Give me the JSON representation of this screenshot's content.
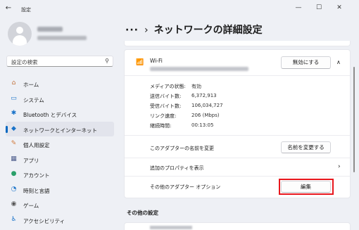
{
  "window": {
    "app_title": "設定",
    "minimize": "—",
    "maximize": "☐",
    "close": "✕"
  },
  "search": {
    "placeholder": "設定の検索"
  },
  "sidebar": {
    "items": [
      {
        "label": "ホーム",
        "icon": "home-icon",
        "glyph": "⌂",
        "color": "#c2733d",
        "active": false
      },
      {
        "label": "システム",
        "icon": "system-icon",
        "glyph": "▭",
        "color": "#1a73c9",
        "active": false
      },
      {
        "label": "Bluetooth とデバイス",
        "icon": "bluetooth-icon",
        "glyph": "✱",
        "color": "#1a73c9",
        "active": false
      },
      {
        "label": "ネットワークとインターネット",
        "icon": "network-icon",
        "glyph": "◆",
        "color": "#1a73c9",
        "active": true
      },
      {
        "label": "個人用設定",
        "icon": "personalize-icon",
        "glyph": "✎",
        "color": "#d1793a",
        "active": false
      },
      {
        "label": "アプリ",
        "icon": "apps-icon",
        "glyph": "▦",
        "color": "#4a5a8a",
        "active": false
      },
      {
        "label": "アカウント",
        "icon": "account-icon",
        "glyph": "●",
        "color": "#2aa06a",
        "active": false
      },
      {
        "label": "時刻と言語",
        "icon": "time-language-icon",
        "glyph": "◔",
        "color": "#1a73c9",
        "active": false
      },
      {
        "label": "ゲーム",
        "icon": "game-icon",
        "glyph": "◉",
        "color": "#555555",
        "active": false
      },
      {
        "label": "アクセシビリティ",
        "icon": "accessibility-icon",
        "glyph": "♿",
        "color": "#1a73c9",
        "active": false
      }
    ]
  },
  "header": {
    "dots": "···",
    "separator": "›",
    "title": "ネットワークの詳細設定"
  },
  "adapter": {
    "name": "Wi-Fi",
    "disable_label": "無効にする",
    "properties": [
      {
        "label": "メディアの状態:",
        "value": "有効"
      },
      {
        "label": "送信バイト数:",
        "value": "6,372,913"
      },
      {
        "label": "受信バイト数:",
        "value": "106,034,727"
      },
      {
        "label": "リンク速度:",
        "value": "206 (Mbps)"
      },
      {
        "label": "継続時間:",
        "value": "00:13:05"
      }
    ],
    "rename_row_label": "このアダプターの名前を変更",
    "rename_button": "名前を変更する",
    "more_props_label": "追加のプロパティを表示",
    "options_label": "その他のアダプター オプション",
    "edit_button": "編集"
  },
  "other_settings": {
    "heading": "その他の設定"
  },
  "colors": {
    "accent": "#0067c0",
    "highlight": "#e8171d"
  }
}
